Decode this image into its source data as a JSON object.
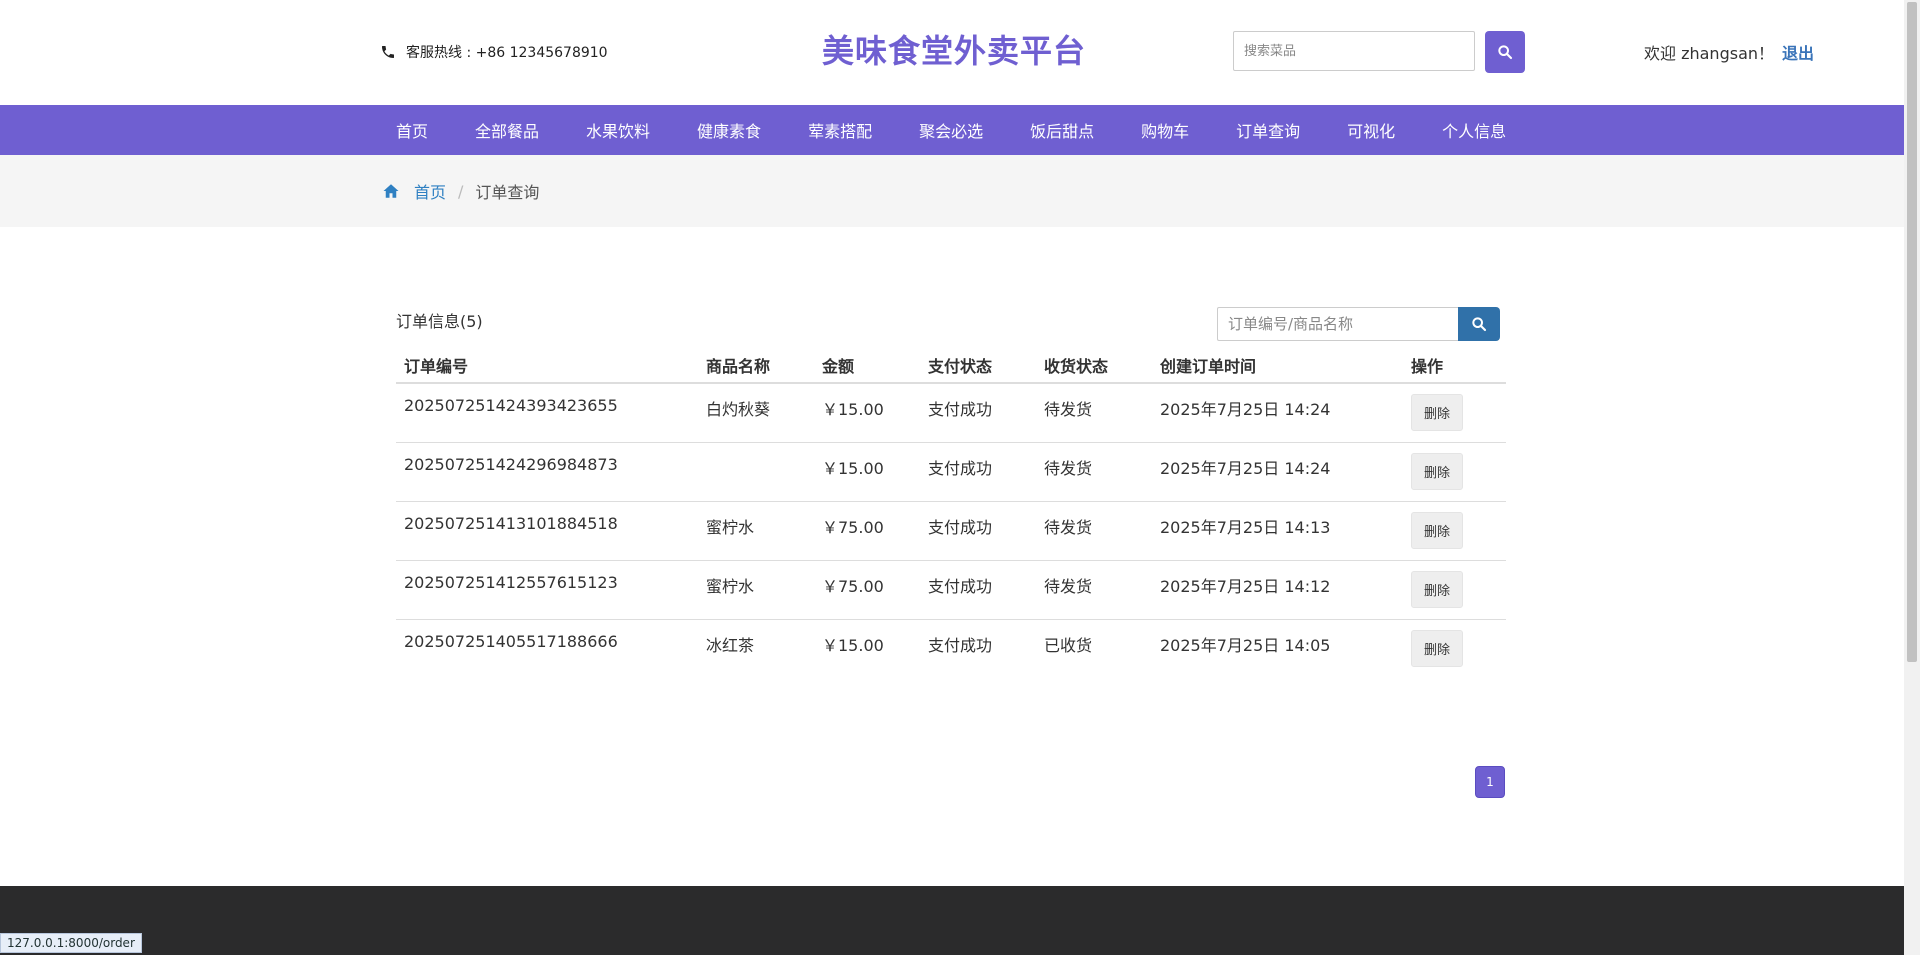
{
  "header": {
    "hotline_text": "客服热线 : +86 12345678910",
    "brand": "美味食堂外卖平台",
    "search_placeholder": "搜索菜品",
    "welcome_text": "欢迎 zhangsan！",
    "logout": "退出"
  },
  "nav": {
    "items": [
      {
        "label": "首页"
      },
      {
        "label": "全部餐品"
      },
      {
        "label": "水果饮料"
      },
      {
        "label": "健康素食"
      },
      {
        "label": "荤素搭配"
      },
      {
        "label": "聚会必选"
      },
      {
        "label": "饭后甜点"
      },
      {
        "label": "购物车"
      },
      {
        "label": "订单查询"
      },
      {
        "label": "可视化"
      },
      {
        "label": "个人信息"
      }
    ]
  },
  "breadcrumb": {
    "home": "首页",
    "separator": "/",
    "current": "订单查询"
  },
  "orders": {
    "title": "订单信息(5)",
    "search_placeholder": "订单编号/商品名称",
    "columns": [
      "订单编号",
      "商品名称",
      "金额",
      "支付状态",
      "收货状态",
      "创建订单时间",
      "操作"
    ],
    "delete_label": "删除",
    "rows": [
      {
        "id": "20250725142439342365 5",
        "name": "白灼秋葵",
        "amount": "￥15.00",
        "pay": "支付成功",
        "ship": "待发货",
        "time": "2025年7月25日 14:24"
      },
      {
        "id": "20250725142429698487 3",
        "name": "",
        "amount": "￥15.00",
        "pay": "支付成功",
        "ship": "待发货",
        "time": "2025年7月25日 14:24"
      },
      {
        "id": "20250725141310188451 8",
        "name": "蜜柠水",
        "amount": "￥75.00",
        "pay": "支付成功",
        "ship": "待发货",
        "time": "2025年7月25日 14:13"
      },
      {
        "id": "20250725141255761512 3",
        "name": "蜜柠水",
        "amount": "￥75.00",
        "pay": "支付成功",
        "ship": "待发货",
        "time": "2025年7月25日 14:12"
      },
      {
        "id": "20250725140551718866 6",
        "name": "冰红茶",
        "amount": "￥15.00",
        "pay": "支付成功",
        "ship": "已收货",
        "time": "2025年7月25日 14:05"
      }
    ]
  },
  "pagination": {
    "current": "1"
  },
  "status_url": "127.0.0.1:8000/order",
  "colors": {
    "brand": "#6f5fd1",
    "link": "#2f80c2",
    "search_button": "#3071a9",
    "footer": "#2b2b2c"
  },
  "icons": {
    "hotline": "phone-icon",
    "search": "search-icon",
    "home": "home-icon"
  }
}
